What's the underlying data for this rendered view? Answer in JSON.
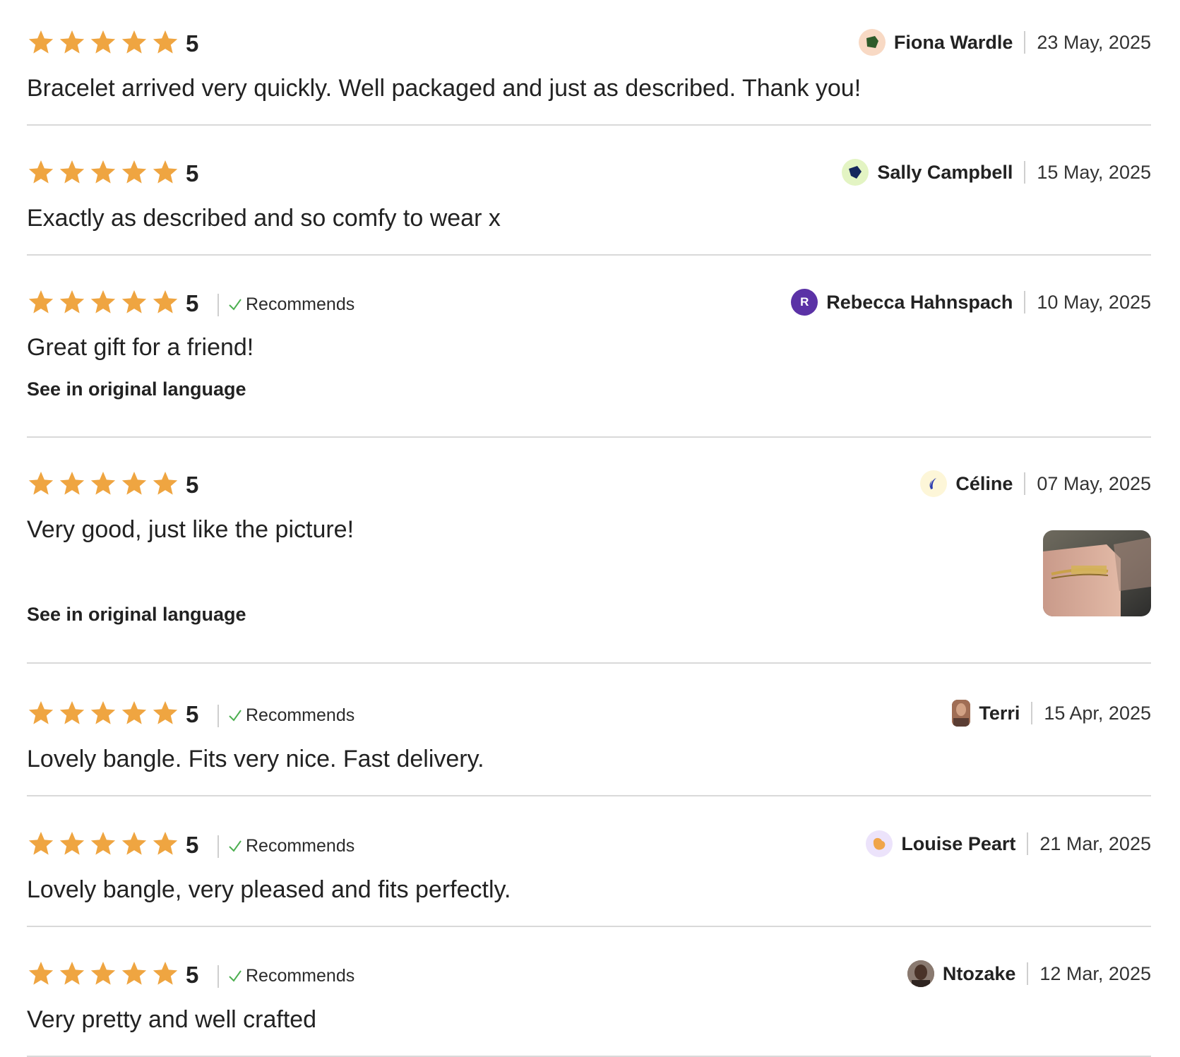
{
  "colors": {
    "star": "#EFA541",
    "divider": "#d9d9d9",
    "recommend_check": "#4caf50"
  },
  "see_original_label": "See in original language",
  "recommends_label": "Recommends",
  "reviews": [
    {
      "rating": "5",
      "stars": 5,
      "recommends": false,
      "author": "Fiona Wardle",
      "date": "23 May, 2025",
      "text": "Bracelet arrived very quickly. Well packaged and just as described. Thank you!",
      "avatar_icon": "green-shield-avatar-icon"
    },
    {
      "rating": "5",
      "stars": 5,
      "recommends": false,
      "author": "Sally Campbell",
      "date": "15 May, 2025",
      "text": "Exactly as described and so comfy to wear x",
      "avatar_icon": "navy-shield-avatar-icon"
    },
    {
      "rating": "5",
      "stars": 5,
      "recommends": true,
      "author": "Rebecca Hahnspach",
      "date": "10 May, 2025",
      "text": "Great gift for a friend!",
      "avatar_letter": "R",
      "see_original": true
    },
    {
      "rating": "5",
      "stars": 5,
      "recommends": false,
      "author": "Céline",
      "date": "07 May, 2025",
      "text": "Very good, just like the picture!",
      "avatar_icon": "blue-crescent-avatar-icon",
      "see_original": true,
      "has_photo": true
    },
    {
      "rating": "5",
      "stars": 5,
      "recommends": true,
      "author": "Terri",
      "date": "15 Apr, 2025",
      "text": "Lovely bangle. Fits very nice. Fast delivery.",
      "avatar_icon": "photo-avatar-icon"
    },
    {
      "rating": "5",
      "stars": 5,
      "recommends": true,
      "author": "Louise Peart",
      "date": "21 Mar, 2025",
      "text": "Lovely bangle, very pleased and fits perfectly.",
      "avatar_icon": "orange-blob-avatar-icon"
    },
    {
      "rating": "5",
      "stars": 5,
      "recommends": true,
      "author": "Ntozake",
      "date": "12 Mar, 2025",
      "text": "Very pretty and well crafted",
      "avatar_icon": "photo-avatar-icon"
    }
  ]
}
